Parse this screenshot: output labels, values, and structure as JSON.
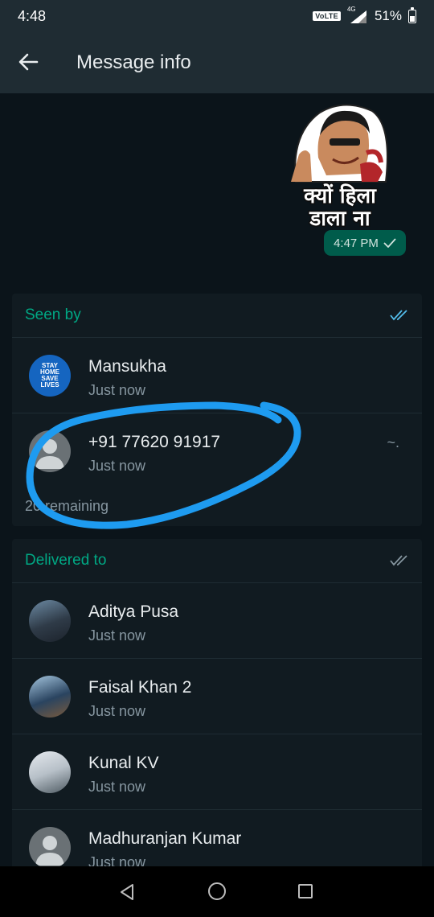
{
  "status_bar": {
    "time": "4:48",
    "volte": "VoLTE",
    "network": "4G",
    "battery": "51%",
    "battery_level": 0.51
  },
  "header": {
    "title": "Message info"
  },
  "message": {
    "sticker_caption_line1": "क्यों हिला",
    "sticker_caption_line2": "डाला ना",
    "time": "4:47 PM"
  },
  "seen_by": {
    "label": "Seen by",
    "contacts": [
      {
        "name": "Mansukha",
        "time": "Just now",
        "avatar_text": [
          "STAY",
          "HOME",
          "SAVE",
          "LIVES"
        ]
      },
      {
        "name": "+91 77620 91917",
        "time": "Just now",
        "about": "~."
      }
    ],
    "remaining": "20 remaining"
  },
  "delivered_to": {
    "label": "Delivered to",
    "contacts": [
      {
        "name": "Aditya Pusa",
        "time": "Just now"
      },
      {
        "name": "Faisal Khan 2",
        "time": "Just now"
      },
      {
        "name": "Kunal KV",
        "time": "Just now"
      },
      {
        "name": "Madhuranjan Kumar",
        "time": "Just now"
      }
    ]
  },
  "colors": {
    "accent": "#00a884",
    "read_ticks": "#53bdeb",
    "annotation": "#1e9bf0"
  }
}
